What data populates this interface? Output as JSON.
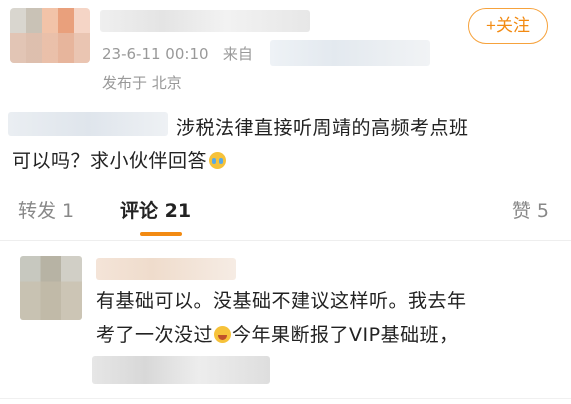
{
  "post": {
    "follow_label": "+关注",
    "timestamp": "23-6-11 00:10",
    "source_prefix": "来自",
    "location": "发布于 北京",
    "text_line1": "涉税法律直接听周靖的高频考点班",
    "text_line2": "可以吗？求小伙伴回答"
  },
  "tabs": {
    "repost": "转发 1",
    "comment": "评论 21",
    "like": "赞 5"
  },
  "comment": {
    "line1": "有基础可以。没基础不建议这样听。我去年",
    "line2_a": "考了一次没过",
    "line2_b": "今年果断报了VIP基础班，"
  },
  "colors": {
    "accent": "#f28a12",
    "meta_text": "#999999",
    "body_text": "#222222"
  },
  "icons": {
    "post_emoji": "crying-emoji-icon",
    "comment_emoji": "laughing-tears-emoji-icon"
  }
}
